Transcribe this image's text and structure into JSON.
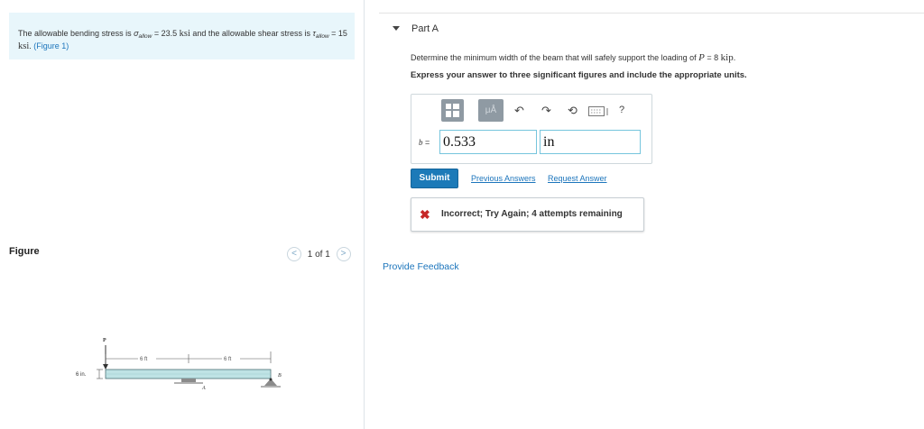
{
  "intro": {
    "text_1": "The allowable bending stress is ",
    "sigma": "σ",
    "sigma_sub": "allow",
    "eq_1": " = 23.5 ",
    "unit_1": "ksi",
    "text_2": " and the allowable shear stress is ",
    "tau": "τ",
    "tau_sub": "allow",
    "eq_2": " = 15 ",
    "unit_2": "ksi",
    "period": ".",
    "figure_link": "(Figure 1)"
  },
  "figure_panel": {
    "label": "Figure",
    "prev": "<",
    "pager": "1 of 1",
    "next": ">",
    "load_label": "P",
    "dim_left": "6 ft",
    "dim_right": "6 ft",
    "height_label": "6 in.",
    "support_a": "A",
    "support_b": "B"
  },
  "part": {
    "title": "Part A",
    "question_1": "Determine the minimum width of the beam that will safely support the loading of ",
    "question_var": "P",
    "question_2": " = 8 ",
    "question_unit": "kip",
    "question_end": ".",
    "instructions": "Express your answer to three significant figures and include the appropriate units."
  },
  "toolbar": {
    "units_label": "μÅ",
    "help_label": "?"
  },
  "answer": {
    "var_label": "b",
    "equals": " =",
    "value": "0.533",
    "unit": "in"
  },
  "actions": {
    "submit": "Submit",
    "previous_answers": "Previous Answers",
    "request_answer": "Request Answer"
  },
  "feedback": {
    "icon": "✖",
    "message": "Incorrect; Try Again; 4 attempts remaining"
  },
  "provide_feedback": "Provide Feedback",
  "colors": {
    "accent": "#1c75bc",
    "submit_bg": "#1c7ab8",
    "intro_bg": "#e8f6fb",
    "error": "#c62828"
  }
}
